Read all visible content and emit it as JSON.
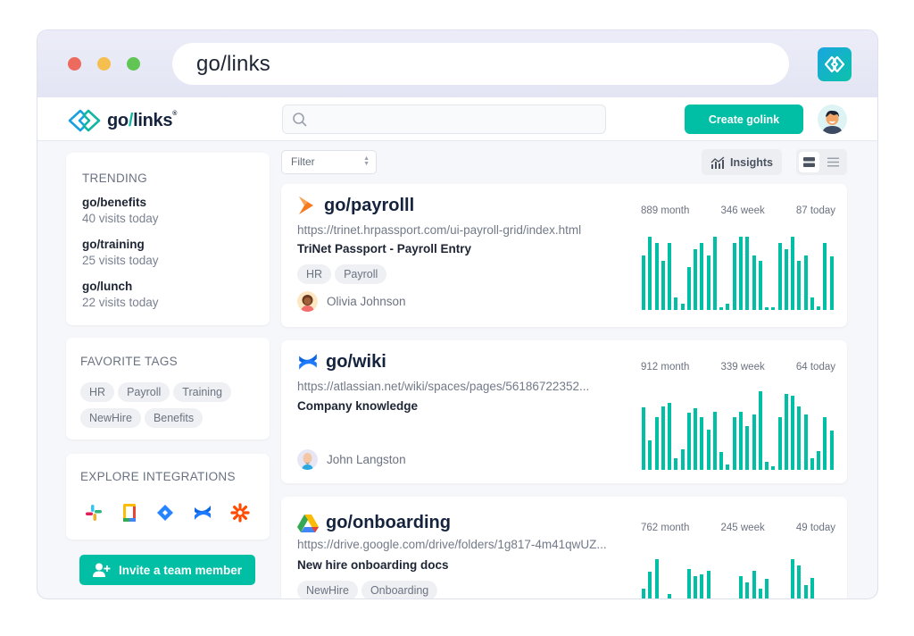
{
  "browser": {
    "url": "go/links",
    "extension_icon": "golinks-extension-icon"
  },
  "header": {
    "logo_text_go": "go",
    "logo_text_slash": "/",
    "logo_text_links": "links",
    "logo_reg": "®",
    "search_placeholder": "",
    "create_button": "Create golink"
  },
  "sidebar": {
    "trending": {
      "title": "TRENDING",
      "items": [
        {
          "name": "go/benefits",
          "visits": "40 visits today"
        },
        {
          "name": "go/training",
          "visits": "25 visits today"
        },
        {
          "name": "go/lunch",
          "visits": "22 visits today"
        }
      ]
    },
    "favorite_tags": {
      "title": "FAVORITE TAGS",
      "tags": [
        "HR",
        "Payroll",
        "Training",
        "NewHire",
        "Benefits"
      ]
    },
    "integrations": {
      "title": "EXPLORE INTEGRATIONS",
      "items": [
        "slack-icon",
        "google-docs-icon",
        "jira-icon",
        "confluence-icon",
        "zapier-icon"
      ]
    },
    "invite_button": "Invite a team member"
  },
  "toolbar": {
    "filter_label": "Filter",
    "insights_label": "Insights",
    "view_modes": [
      "card-view",
      "list-view"
    ],
    "active_view": "card-view"
  },
  "links": [
    {
      "name": "go/payrolll",
      "icon": "trinet-icon",
      "url": "https://trinet.hrpassport.com/ui-payroll-grid/index.html",
      "description": "TriNet Passport - Payroll Entry",
      "tags": [
        "HR",
        "Payroll"
      ],
      "owner": "Olivia Johnson",
      "stats": {
        "month": "889 month",
        "week": "346 week",
        "today": "87 today"
      },
      "accent": "#00bfa5",
      "daily_visits": [
        0.75,
        1.0,
        0.92,
        0.67,
        0.92,
        0.17,
        0.08,
        0.58,
        0.83,
        0.92,
        0.75,
        1.0,
        0.03,
        0.08,
        0.92,
        1.0,
        1.0,
        0.75,
        0.67,
        0.03,
        0.03,
        0.92,
        0.83,
        1.0,
        0.67,
        0.75,
        0.17,
        0.05,
        0.92,
        0.73
      ]
    },
    {
      "name": "go/wiki",
      "icon": "confluence-icon",
      "url": "https://atlassian.net/wiki/spaces/pages/56186722352...",
      "description": "Company knowledge",
      "tags": [],
      "owner": "John Langston",
      "stats": {
        "month": "912 month",
        "week": "339 week",
        "today": "64 today"
      },
      "accent": "#00bfa5",
      "daily_visits": [
        0.79,
        0.37,
        0.67,
        0.81,
        0.85,
        0.15,
        0.26,
        0.73,
        0.78,
        0.67,
        0.51,
        0.74,
        0.23,
        0.07,
        0.67,
        0.74,
        0.56,
        0.7,
        1.0,
        0.1,
        0.04,
        0.67,
        0.97,
        0.94,
        0.81,
        0.7,
        0.15,
        0.24,
        0.67,
        0.5
      ]
    },
    {
      "name": "go/onboarding",
      "icon": "google-drive-icon",
      "url": "https://drive.google.com/drive/folders/1g817-4m41qwUZ...",
      "description": "New hire onboarding docs",
      "tags": [
        "NewHire",
        "Onboarding"
      ],
      "owner": "",
      "stats": {
        "month": "762 month",
        "week": "245 week",
        "today": "49 today"
      },
      "accent": "#00bfa5",
      "daily_visits": [
        0.55,
        0.78,
        0.95,
        0.4,
        0.47,
        0.0,
        0.24,
        0.82,
        0.72,
        0.74,
        0.79,
        0.0,
        0.0,
        0.0,
        0.0,
        0.72,
        0.63,
        0.79,
        0.55,
        0.68,
        0.0,
        0.0,
        0.0,
        0.95,
        0.86,
        0.6,
        0.7,
        0.18,
        0.0,
        0.0
      ]
    }
  ]
}
